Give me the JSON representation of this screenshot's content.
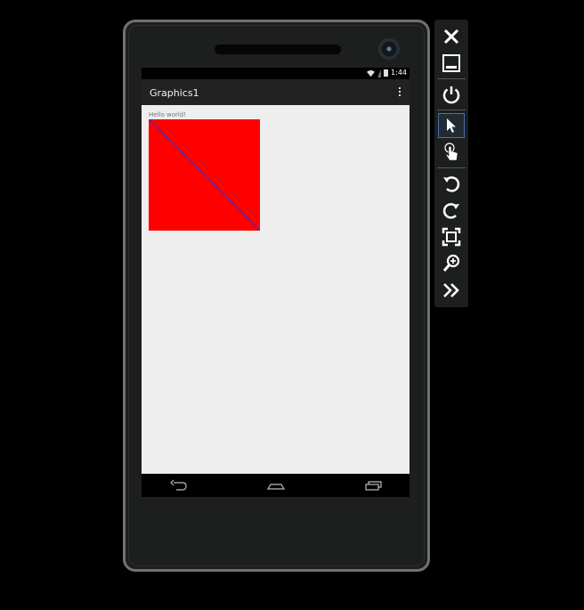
{
  "app": {
    "title": "Graphics1",
    "content_text": "Hello world!"
  },
  "status_bar": {
    "time": "1:44"
  },
  "colors": {
    "canvas_fill": "#ff0000",
    "line_color": "#3333cc",
    "screen_background": "#eeeeee",
    "action_bar": "#222222"
  },
  "icons": {
    "overflow": "overflow-menu-icon",
    "back": "back-icon",
    "home": "home-icon",
    "recents": "recent-apps-icon"
  },
  "toolbar": {
    "tools": [
      "close",
      "minimize",
      "power",
      "pointer",
      "touch",
      "rotate-left",
      "rotate-right",
      "fit-to-screen",
      "zoom",
      "more"
    ],
    "active_tool": "pointer"
  }
}
